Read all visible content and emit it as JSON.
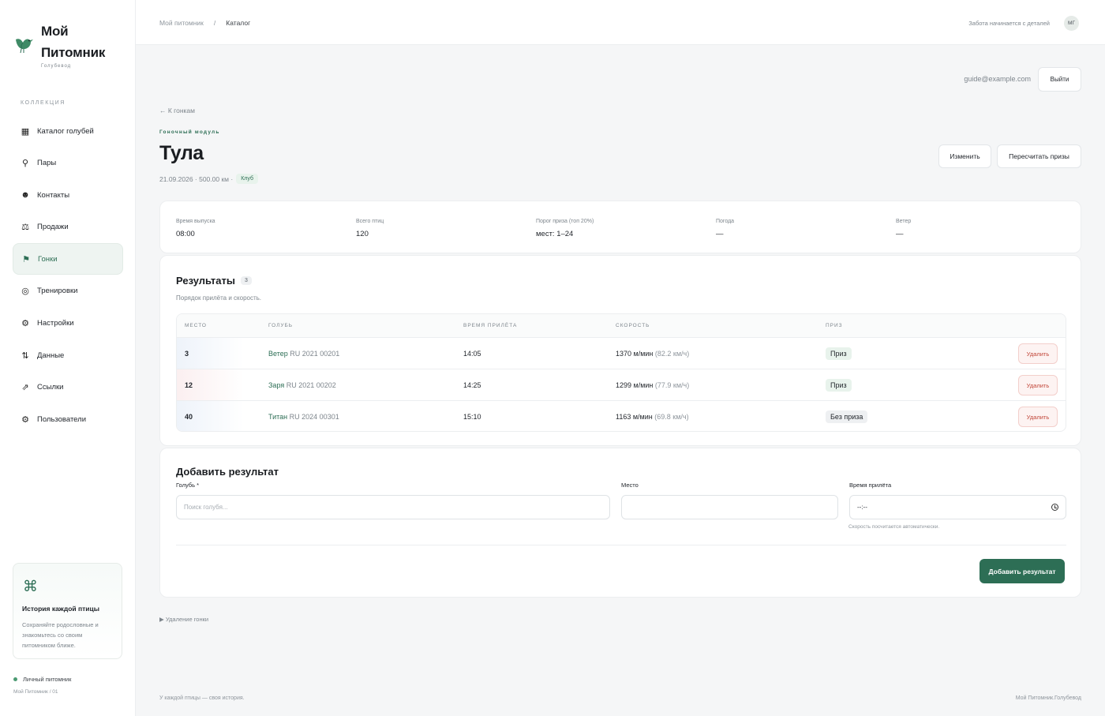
{
  "brand": {
    "title_line1": "Мой",
    "title_line2": "Питомник",
    "subtitle": "Голубевод",
    "accent": "#2d6e55"
  },
  "sidebar": {
    "section": "КОЛЛЕКЦИЯ",
    "items": [
      {
        "label": "Каталог голубей",
        "icon": "grid-icon"
      },
      {
        "label": "Пары",
        "icon": "pin-icon"
      },
      {
        "label": "Контакты",
        "icon": "contacts-icon"
      },
      {
        "label": "Продажи",
        "icon": "scales-icon"
      },
      {
        "label": "Гонки",
        "icon": "flag-icon",
        "active": true
      },
      {
        "label": "Тренировки",
        "icon": "target-icon"
      },
      {
        "label": "Настройки",
        "icon": "gear-icon"
      },
      {
        "label": "Данные",
        "icon": "arrows-updown-icon"
      },
      {
        "label": "Ссылки",
        "icon": "link-arrow-icon"
      },
      {
        "label": "Пользователи",
        "icon": "users-icon"
      }
    ],
    "promo": {
      "title": "История каждой птицы",
      "text": "Сохраняйте родословные и знакомьтесь со своим питомником ближе."
    },
    "footer_status": "Личный питомник",
    "footer_meta": "Мой Питомник / 01"
  },
  "topbar": {
    "breadcrumb_root": "Мой питомник",
    "breadcrumb_sep": "/",
    "breadcrumb_current": "Каталог",
    "tagline": "Забота начинается с деталей",
    "avatar": "МГ"
  },
  "account": {
    "email": "guide@example.com",
    "logout": "Выйти"
  },
  "page": {
    "back": "← К гонкам",
    "module": "Гоночный модуль",
    "title": "Тула",
    "meta": "21.09.2026 · 500.00 км ·",
    "badge": "Клуб",
    "edit": "Изменить",
    "recalc": "Пересчитать призы"
  },
  "stats": [
    {
      "label": "Время выпуска",
      "value": "08:00"
    },
    {
      "label": "Всего птиц",
      "value": "120"
    },
    {
      "label": "Порог приза (топ 20%)",
      "value": "мест: 1–24"
    },
    {
      "label": "Погода",
      "value": "—"
    },
    {
      "label": "Ветер",
      "value": "—"
    }
  ],
  "results": {
    "title": "Результаты",
    "count": "3",
    "subtitle": "Порядок прилёта и скорость.",
    "columns": [
      "МЕСТО",
      "ГОЛУБЬ",
      "ВРЕМЯ ПРИЛЁТА",
      "СКОРОСТЬ",
      "ПРИЗ"
    ],
    "rows": [
      {
        "place": "3",
        "name": "Ветер",
        "ring": "RU 2021 00201",
        "time": "14:05",
        "speed": "1370 м/мин",
        "kmh": "(82.2 км/ч)",
        "prize": "Приз",
        "delete": "Удалить"
      },
      {
        "place": "12",
        "name": "Заря",
        "ring": "RU 2021 00202",
        "time": "14:25",
        "speed": "1299 м/мин",
        "kmh": "(77.9 км/ч)",
        "prize": "Приз",
        "delete": "Удалить"
      },
      {
        "place": "40",
        "name": "Титан",
        "ring": "RU 2024 00301",
        "time": "15:10",
        "speed": "1163 м/мин",
        "kmh": "(69.8 км/ч)",
        "prize": "Без приза",
        "delete": "Удалить"
      }
    ]
  },
  "add_form": {
    "title": "Добавить результат",
    "pigeon_label": "Голубь *",
    "pigeon_placeholder": "Поиск голубя...",
    "place_label": "Место",
    "time_label": "Время прилёта",
    "time_value": "--:--",
    "hint": "Скорость посчитается автоматически.",
    "submit": "Добавить результат"
  },
  "delete_race": "▶ Удаление гонки",
  "footer": {
    "left": "У каждой птицы — своя история.",
    "right": "Мой Питомник.Голубевод"
  }
}
